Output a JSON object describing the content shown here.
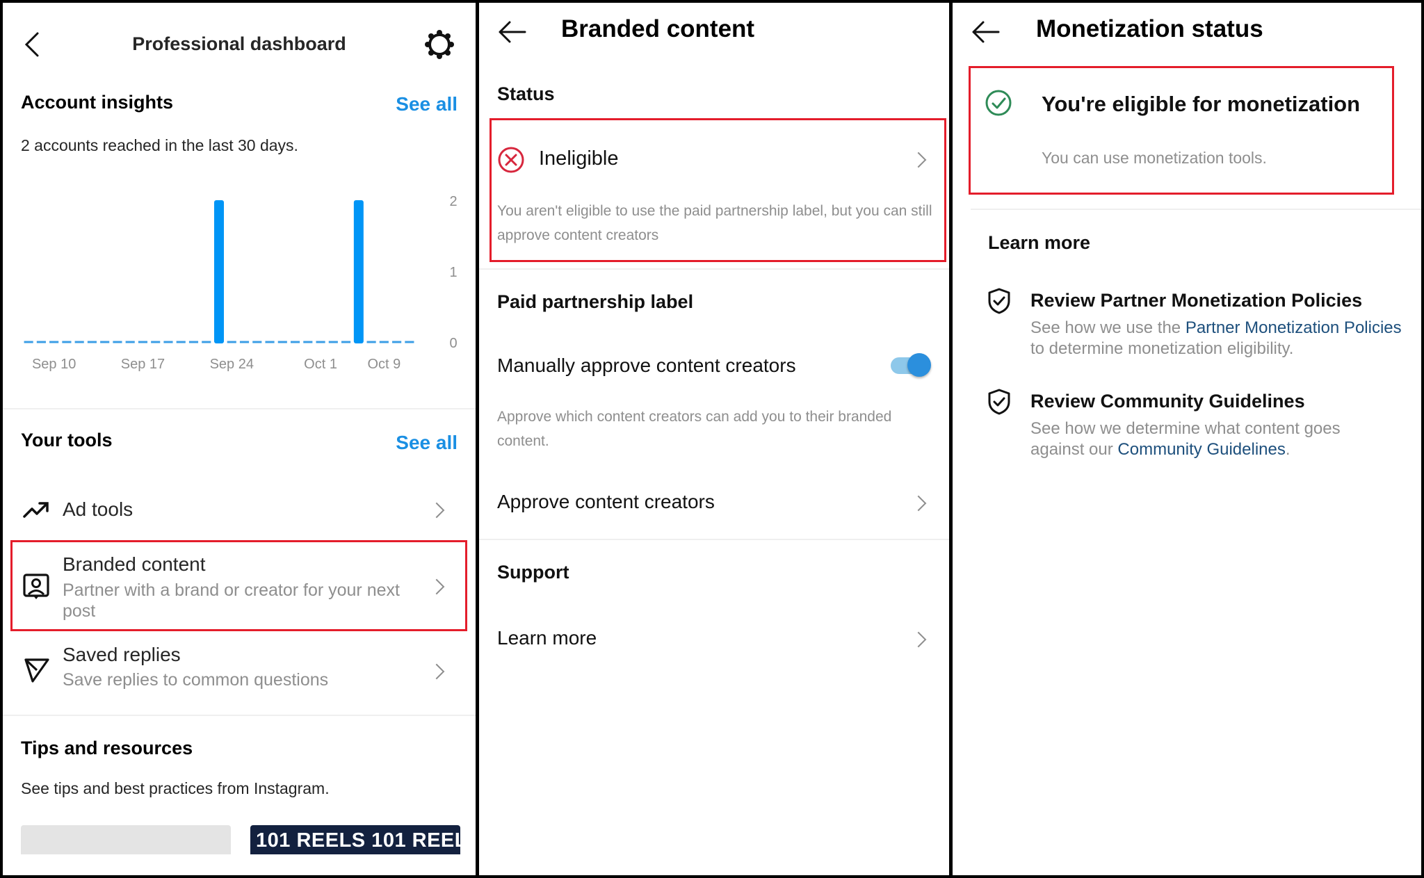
{
  "dashboard": {
    "title": "Professional dashboard",
    "account_insights": {
      "heading": "Account insights",
      "see_all": "See all",
      "summary": "2 accounts reached in the last 30 days."
    },
    "your_tools": {
      "heading": "Your tools",
      "see_all": "See all",
      "items": [
        {
          "icon": "trending-up-icon",
          "title": "Ad tools",
          "subtitle": ""
        },
        {
          "icon": "branded-content-icon",
          "title": "Branded content",
          "subtitle": "Partner with a brand or creator for your next post",
          "highlighted": true
        },
        {
          "icon": "send-icon",
          "title": "Saved replies",
          "subtitle": "Save replies to common questions"
        }
      ]
    },
    "tips": {
      "heading": "Tips and resources",
      "description": "See tips and best practices from Instagram.",
      "cards": [
        {
          "label": ""
        },
        {
          "label": "101 REELS 101 REEL"
        }
      ]
    }
  },
  "branded_content": {
    "title": "Branded content",
    "status_heading": "Status",
    "status": {
      "icon": "x-circle-icon",
      "label": "Ineligible",
      "description": "You aren't eligible to use the paid partnership label, but you can still approve content creators",
      "highlighted": true
    },
    "paid_partnership": {
      "heading": "Paid partnership label",
      "toggle_label": "Manually approve content creators",
      "toggle_on": true,
      "toggle_description": "Approve which content creators can add you to their branded content.",
      "approve_link": "Approve content creators"
    },
    "support": {
      "heading": "Support",
      "learn_more": "Learn more"
    }
  },
  "monetization": {
    "title": "Monetization status",
    "status": {
      "icon": "check-circle-icon",
      "title": "You're eligible for monetization",
      "description": "You can use monetization tools.",
      "highlighted": true
    },
    "learn_more": {
      "heading": "Learn more",
      "items": [
        {
          "icon": "shield-check-icon",
          "title": "Review Partner Monetization Policies",
          "desc_before": "See how we use the ",
          "link": "Partner Monetization Policies",
          "desc_after": " to determine monetization eligibility."
        },
        {
          "icon": "shield-check-icon",
          "title": "Review Community Guidelines",
          "desc_before": "See how we determine what content goes against our ",
          "link": "Community Guidelines",
          "desc_after": "."
        }
      ]
    }
  },
  "colors": {
    "accent_blue": "#1a8fe3",
    "bar_blue": "#0095f6",
    "highlight_red": "#e41d2b",
    "error_red": "#d7263d",
    "success_green": "#2e8b57",
    "link_blue": "#1d4f7c",
    "secondary_text": "#8e8e8e"
  },
  "chart_data": {
    "type": "bar",
    "title": "",
    "xlabel": "",
    "ylabel": "",
    "ylim": [
      0,
      2
    ],
    "y_ticks": [
      "0",
      "1",
      "2"
    ],
    "x_tick_labels": [
      "Sep 10",
      "Sep 17",
      "Sep 24",
      "Oct 1",
      "Oct 9"
    ],
    "x_tick_indices": [
      2,
      9,
      16,
      23,
      28
    ],
    "values": [
      0,
      0,
      0,
      0,
      0,
      0,
      0,
      0,
      0,
      0,
      0,
      0,
      0,
      0,
      0,
      2,
      0,
      0,
      0,
      0,
      0,
      0,
      0,
      0,
      0,
      0,
      2,
      0,
      0,
      0,
      0
    ],
    "grid": false,
    "legend": "none",
    "zero_marker": "dashed"
  }
}
